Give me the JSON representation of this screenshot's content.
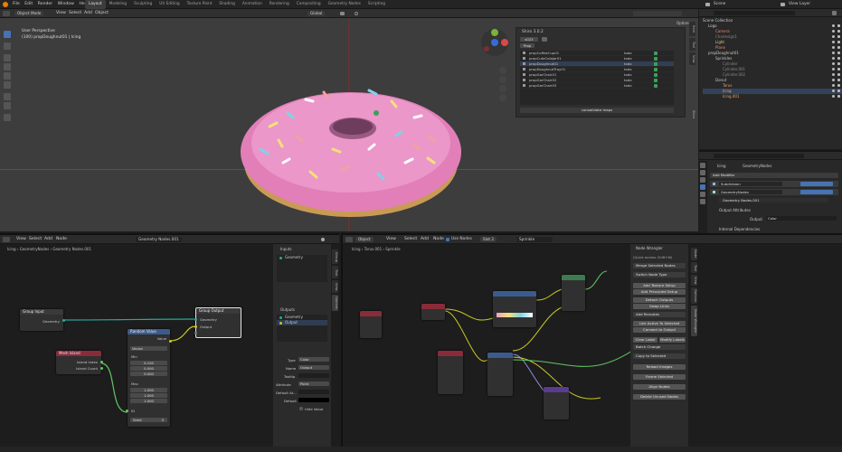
{
  "topbar": {
    "menus": [
      "File",
      "Edit",
      "Render",
      "Window",
      "Help"
    ],
    "workspaces": [
      "Layout",
      "Modeling",
      "Sculpting",
      "UV Editing",
      "Texture Paint",
      "Shading",
      "Animation",
      "Rendering",
      "Compositing",
      "Geometry Nodes",
      "Scripting"
    ],
    "scene": "Scene",
    "view_layer": "View Layer"
  },
  "viewport": {
    "mode": "Object Mode",
    "menus": [
      "View",
      "Select",
      "Add",
      "Object"
    ],
    "transform": "Global",
    "info1": "User Perspective",
    "info2": "(100) propDoughnut01 | Icing",
    "options": "Options"
  },
  "shiro": {
    "title": "Shiro 3.0.2",
    "field": "s023",
    "filter": "Prop",
    "rows": [
      {
        "name": "propCoffeeCup01",
        "status": "todo"
      },
      {
        "name": "propCuteColaJar01",
        "status": "todo"
      },
      {
        "name": "propDoughnut01",
        "status": "todo"
      },
      {
        "name": "propDoughnutTray01",
        "status": "todo"
      },
      {
        "name": "propGarChair01",
        "status": "todo"
      },
      {
        "name": "propGarChair02",
        "status": "todo"
      },
      {
        "name": "propGarChair03",
        "status": "todo"
      }
    ],
    "button": "consolidate maps"
  },
  "outliner": {
    "root": "Scene Collection",
    "items": [
      {
        "label": "Logo",
        "indent": 1
      },
      {
        "label": "Camera",
        "indent": 2
      },
      {
        "label": "Charlesign1",
        "indent": 2
      },
      {
        "label": "Light",
        "indent": 2
      },
      {
        "label": "Plane",
        "indent": 2
      },
      {
        "label": "propDoughnut01",
        "indent": 1
      },
      {
        "label": "Sprinkles",
        "indent": 2
      },
      {
        "label": "Cylinder",
        "indent": 3
      },
      {
        "label": "Cylinder.001",
        "indent": 3
      },
      {
        "label": "Cylinder.002",
        "indent": 3
      },
      {
        "label": "Donut",
        "indent": 2
      },
      {
        "label": "Torus",
        "indent": 3
      },
      {
        "label": "Icing",
        "indent": 3
      },
      {
        "label": "Icing.001",
        "indent": 3
      }
    ]
  },
  "properties": {
    "path": [
      "Icing",
      "GeometryNodes"
    ],
    "add_modifier": "Add Modifier",
    "modifiers": [
      "Subdivision",
      "GeometryNodes"
    ],
    "node_group": "Geometry Nodes.001",
    "output_attributes": "Output Attributes",
    "output_label": "Output",
    "output_value": "Color",
    "internal_deps": "Internal Dependencies"
  },
  "gn_editor": {
    "menus": [
      "View",
      "Select",
      "Add",
      "Node"
    ],
    "node_group": "Geometry Nodes.001",
    "breadcrumb": [
      "Icing",
      "GeometryNodes",
      "Geometry Nodes.001"
    ],
    "group_input": {
      "title": "Group Input",
      "geometry": "Geometry"
    },
    "group_output": {
      "title": "Group Output",
      "geometry": "Geometry",
      "output": "Output"
    },
    "random_value": {
      "title": "Random Value",
      "value": "Value",
      "type": "Vector",
      "min": "Min",
      "max": "Max",
      "min_vals": [
        "0.100",
        "0.000",
        "0.000"
      ],
      "max_vals": [
        "1.000",
        "1.000",
        "1.000"
      ],
      "id": "ID",
      "seed_label": "Seed",
      "seed": "0"
    },
    "mesh_island": {
      "title": "Mesh Island",
      "island_index": "Island Index",
      "island_count": "Island Count"
    }
  },
  "gn_sidebar": {
    "inputs_label": "Inputs",
    "inputs": [
      "Geometry"
    ],
    "outputs_label": "Outputs",
    "outputs": [
      "Geometry",
      "Output"
    ],
    "type_label": "Type",
    "type": "Color",
    "name_label": "Name",
    "name": "Output",
    "tooltip_label": "Tooltip",
    "attribute_label": "Attribute",
    "attribute": "Point",
    "default_label": "Default At...",
    "default2_label": "Default",
    "hide_value": "Hide Value",
    "tabs": [
      "Group",
      "Tool",
      "View",
      "Options"
    ]
  },
  "shader_editor": {
    "mode": "Object",
    "menus": [
      "View",
      "Select",
      "Add",
      "Node"
    ],
    "use_nodes": "Use Nodes",
    "slot": "Slot 2",
    "material": "Sprinkle",
    "breadcrumb": [
      "Icing",
      "Torus.001",
      "Sprinkle"
    ]
  },
  "node_wrangler": {
    "title": "Node Wrangler",
    "quick_access": "(Quick access: Shift+W)",
    "merge": "Merge Selected Nodes",
    "switch": "Switch Node Type",
    "buttons": [
      "Add Texture Setup",
      "Add Principled Setup",
      "Add Reroutes"
    ],
    "detach": "Detach Outputs",
    "swap": "Swap Links",
    "add_reroutes": "Add Reroutes",
    "link_active": "Link Active To Selected",
    "connect_output": "Connect to Output",
    "clear_label": "Clear Label",
    "modify_labels": "Modify Labels",
    "batch_change": "Batch Change",
    "copy_selected": "Copy to Selected",
    "reload_images": "Reload Images",
    "frame_selected": "Frame Selected",
    "align_nodes": "Align Nodes",
    "delete_unused": "Delete Unused Nodes",
    "tabs": [
      "Node",
      "Tool",
      "View",
      "Options",
      "Node Wrangler"
    ]
  },
  "colors": {
    "accent": "#4772b3",
    "donut_pink": "#e27fb8",
    "dough": "#c99a55",
    "node_group": "#1e4c4c",
    "node_input": "#8a2b3a",
    "node_converter": "#3b5b8f",
    "node_shader": "#3d7a52"
  }
}
